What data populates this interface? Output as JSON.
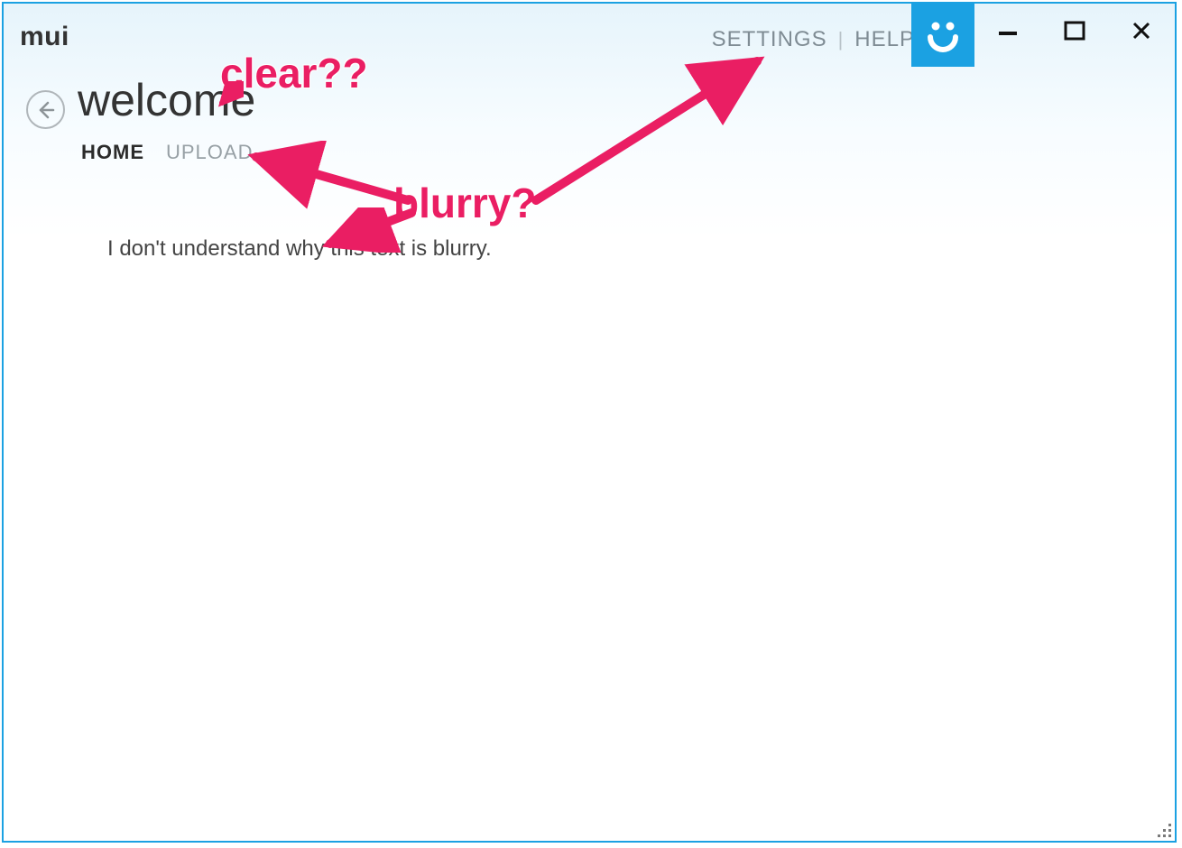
{
  "app": {
    "logo_text": "mui"
  },
  "header": {
    "links": {
      "settings": "SETTINGS",
      "help": "HELP"
    },
    "smiley_icon": "smiley-icon",
    "window_controls": {
      "minimize": "minimize",
      "maximize": "maximize",
      "close": "close"
    }
  },
  "page": {
    "title": "welcome",
    "tabs": [
      {
        "label": "HOME",
        "active": true
      },
      {
        "label": "UPLOAD",
        "active": false
      }
    ],
    "body_text": "I don't understand why this text is blurry."
  },
  "annotations": {
    "clear_label": "clear??",
    "blurry_label": "blurry?"
  },
  "colors": {
    "accent": "#1ba1e2",
    "annotation": "#ea1e63"
  }
}
